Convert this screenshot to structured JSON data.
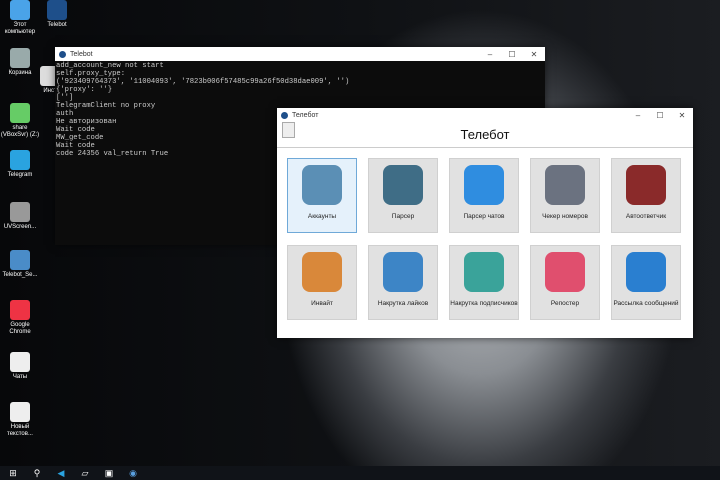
{
  "desktop": {
    "icons": [
      "Этот компьютер",
      "Telebot",
      "Корзина",
      "Инст",
      "share (VBoxSvr) (Z:)",
      "Telegram",
      "UVScreen...",
      "Telebot_Se...",
      "Google Chrome",
      "Чаты",
      "Новый текстов..."
    ]
  },
  "console": {
    "title": "Telebot",
    "lines": "add_account_new not start\nself.proxy_type:\n('923409764373', '11004093', '7823b006f57485c99a26f50d38dae009', '')\n{'proxy': ''}\n['']\nTelegramClient no proxy\nauth\nНе авторизован\nWait code\nMW_get_code\nWait code\ncode 24356 val_return True"
  },
  "app": {
    "title": "Телебот",
    "header": "Телебот",
    "tiles": [
      {
        "label": "Аккаунты",
        "color": "#5b8fb5"
      },
      {
        "label": "Парсер",
        "color": "#3f6d86"
      },
      {
        "label": "Парсер чатов",
        "color": "#2f8de0"
      },
      {
        "label": "Чекер номеров",
        "color": "#6b7280"
      },
      {
        "label": "Автоответчик",
        "color": "#8a2a2a"
      },
      {
        "label": "Инвайт",
        "color": "#d9883a"
      },
      {
        "label": "Накрутка лайков",
        "color": "#3d85c6"
      },
      {
        "label": "Накрутка подписчиков",
        "color": "#3aa39a"
      },
      {
        "label": "Репостер",
        "color": "#e04f6e"
      },
      {
        "label": "Рассылка сообщений",
        "color": "#2a7fd0"
      }
    ]
  },
  "window_controls": {
    "minimize": "–",
    "maximize": "☐",
    "close": "✕"
  }
}
